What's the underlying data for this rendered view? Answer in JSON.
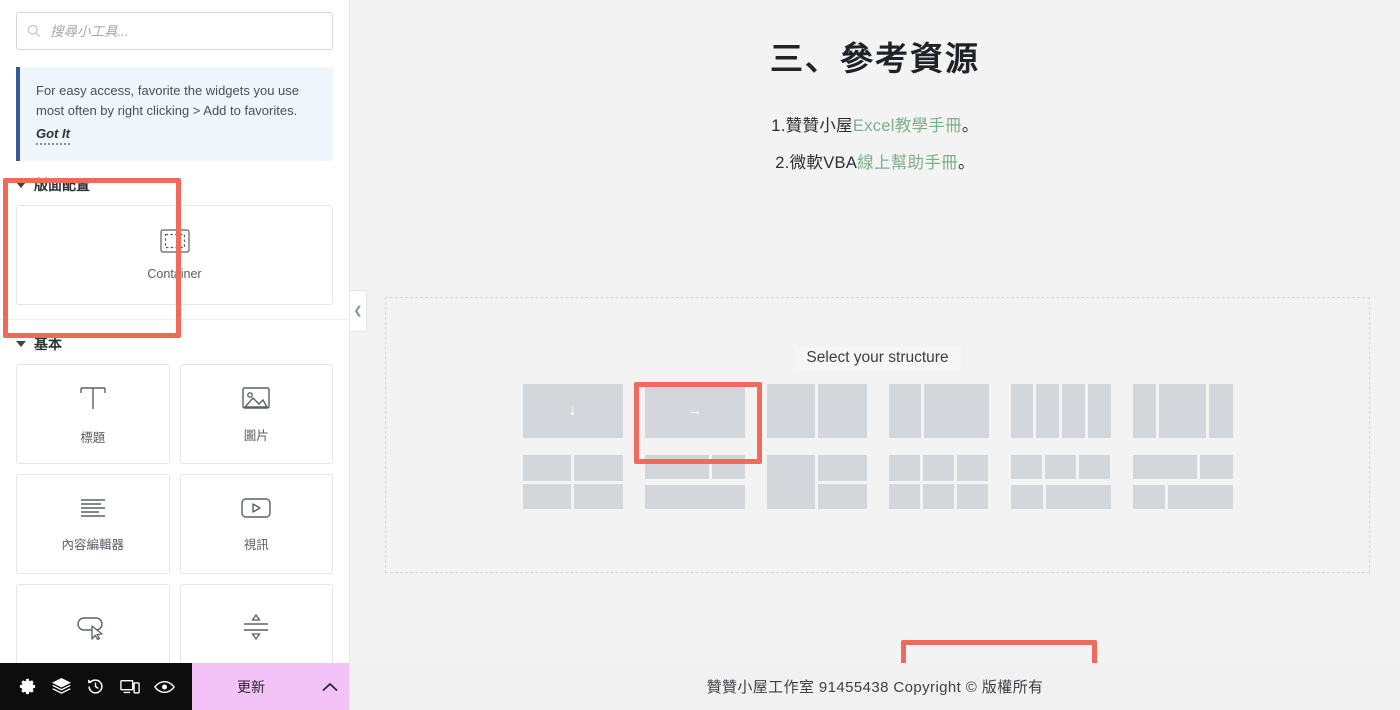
{
  "panel": {
    "search": {
      "placeholder": "搜尋小工具...",
      "value": "",
      "icon": "search-icon"
    },
    "notice": {
      "text": "For easy access, favorite the widgets you use most often by right clicking > Add to favorites.",
      "action_label": "Got It",
      "accent_color": "#3b5998",
      "background_color": "#eff6fc"
    },
    "sections": [
      {
        "title": "版面配置",
        "widgets": [
          {
            "label": "Container",
            "icon": "container-icon"
          }
        ]
      },
      {
        "title": "基本",
        "widgets": [
          {
            "label": "標題",
            "icon": "heading-icon"
          },
          {
            "label": "圖片",
            "icon": "image-icon"
          },
          {
            "label": "內容編輯器",
            "icon": "text-editor-icon"
          },
          {
            "label": "視訊",
            "icon": "video-icon"
          },
          {
            "label": "",
            "icon": "button-icon"
          },
          {
            "label": "",
            "icon": "divider-icon"
          }
        ]
      }
    ],
    "collapse_handle_icon": "chevron-left-icon"
  },
  "bottom_bar": {
    "icons": [
      {
        "name": "gear-icon"
      },
      {
        "name": "layers-icon"
      },
      {
        "name": "history-icon"
      },
      {
        "name": "responsive-icon"
      },
      {
        "name": "preview-icon"
      }
    ],
    "update_label": "更新",
    "update_color": "#f3c2f7",
    "caret_icon": "chevron-up-icon"
  },
  "canvas": {
    "title": "三、參考資源",
    "list": [
      {
        "number": "1.",
        "prefix": "贊贊小屋",
        "link": "Excel教學手冊",
        "suffix": "。"
      },
      {
        "number": "2.",
        "prefix": "微軟VBA",
        "link": "線上幫助手冊",
        "suffix": "。"
      }
    ],
    "link_color": "#7cb08a",
    "dropzone": {
      "select_structure_label": "Select your structure",
      "presets_row1": [
        {
          "name": "single-column-vertical",
          "icon": "arrow-down"
        },
        {
          "name": "single-column-horizontal",
          "icon": "arrow-right"
        },
        {
          "name": "two-equal-columns"
        },
        {
          "name": "two-columns-left-narrow"
        },
        {
          "name": "four-equal-columns"
        },
        {
          "name": "three-columns-wide-middle"
        }
      ],
      "presets_row2": [
        {
          "name": "two-by-two-grid"
        },
        {
          "name": "two-over-one"
        },
        {
          "name": "left-full-right-split"
        },
        {
          "name": "three-by-two-grid"
        },
        {
          "name": "three-over-two"
        },
        {
          "name": "staggered-grid"
        }
      ]
    }
  },
  "footer": {
    "text": "贊贊小屋工作室  91455438 Copyright © 版權所有"
  },
  "annotations": {
    "highlight_color": "#ef6a5a",
    "boxes": [
      {
        "target": "layout-section"
      },
      {
        "target": "select-your-structure-label"
      },
      {
        "target": "first-structure-preset"
      }
    ]
  }
}
